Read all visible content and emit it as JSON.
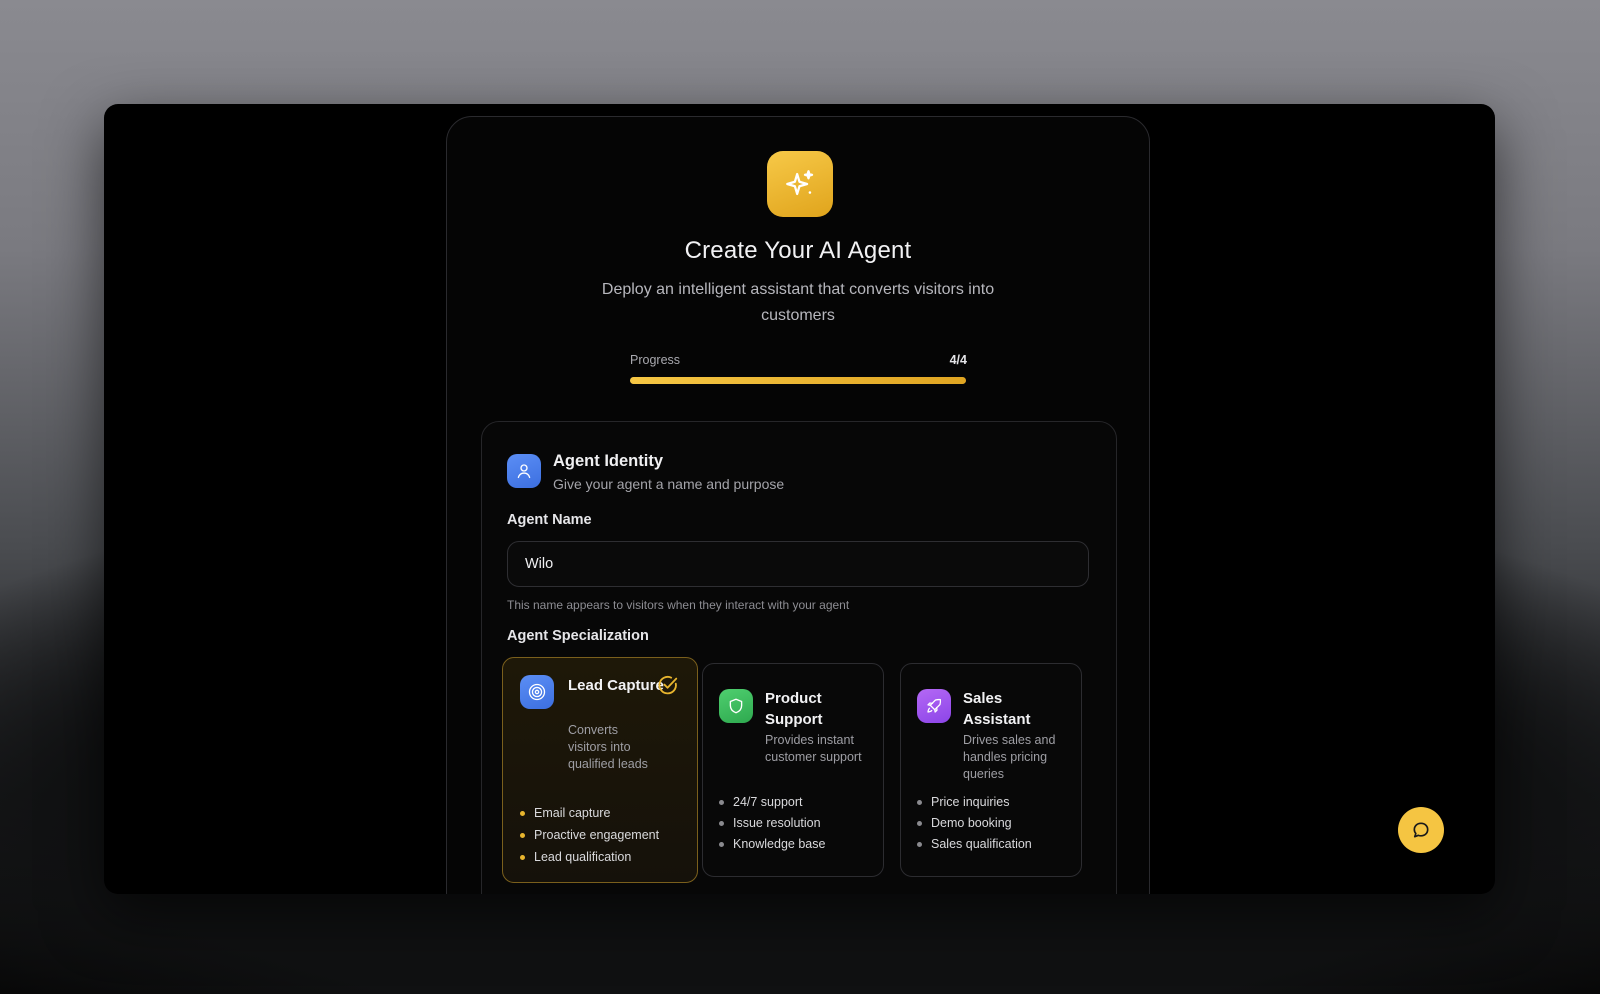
{
  "header": {
    "title": "Create Your AI Agent",
    "subtitle": "Deploy an intelligent assistant that converts visitors into customers",
    "logo_icon": "sparkles-icon"
  },
  "progress": {
    "label": "Progress",
    "count": "4/4",
    "current": 4,
    "total": 4
  },
  "identity": {
    "icon": "user-icon",
    "title": "Agent Identity",
    "subtitle": "Give your agent a name and purpose",
    "name_label": "Agent Name",
    "name_value": "Wilo",
    "name_hint": "This name appears to visitors when they interact with your agent",
    "specialization_label": "Agent Specialization"
  },
  "specializations": [
    {
      "name": "Lead Capture",
      "description": "Converts visitors into qualified leads",
      "icon": "target-icon",
      "color": "#4f86f0",
      "selected": true,
      "features": [
        "Email capture",
        "Proactive engagement",
        "Lead qualification"
      ]
    },
    {
      "name": "Product Support",
      "description": "Provides instant customer support",
      "icon": "shield-icon",
      "color": "#3fbf62",
      "selected": false,
      "features": [
        "24/7 support",
        "Issue resolution",
        "Knowledge base"
      ]
    },
    {
      "name": "Sales Assistant",
      "description": "Drives sales and handles pricing queries",
      "icon": "rocket-icon",
      "color": "#a256f0",
      "selected": false,
      "features": [
        "Price inquiries",
        "Demo booking",
        "Sales qualification"
      ]
    }
  ],
  "chat_button": {
    "icon": "chat-bubble-icon"
  },
  "colors": {
    "accent": "#f5c542",
    "background": "#000000"
  }
}
